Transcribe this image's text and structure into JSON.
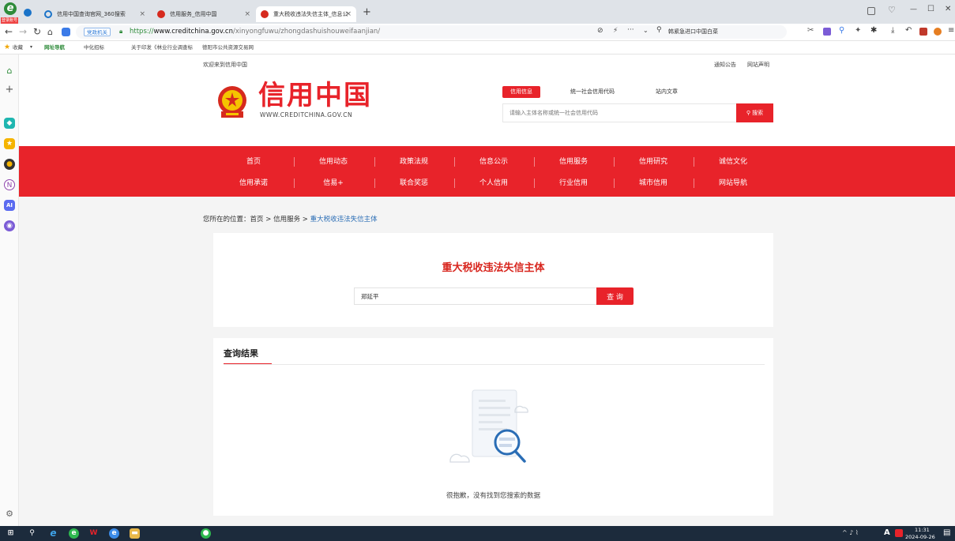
{
  "browser": {
    "profile_label": "登录账号",
    "tabs": [
      {
        "label": "信用中国查询官网_360搜索",
        "close": "×"
      },
      {
        "label": "信用服务_信用中国",
        "close": "×"
      },
      {
        "label": "重大税收违法失信主体_信息公",
        "close": "×"
      }
    ],
    "new_tab": "+",
    "window_controls": [
      "—",
      "☐",
      "✕"
    ],
    "address_badge": "党政机关",
    "url_prefix": "https://",
    "url_domain": "www.creditchina.gov.cn",
    "url_path": "/xinyongfuwu/zhongdashuishouweifaanjian/",
    "search_text": "韩紧急进口中国白菜",
    "bookmarks": [
      "收藏",
      "网址导航",
      "中化招标",
      "关于印发《林业行业调查标",
      "德阳市公共资源交易网"
    ]
  },
  "site": {
    "welcome": "欢迎来到信用中国",
    "top_links": [
      "通知公告",
      "网站声明"
    ],
    "logo_cn": "信用中国",
    "logo_en": "WWW.CREDITCHINA.GOV.CN",
    "search_tabs": [
      "信用信息",
      "统一社会信用代码",
      "站内文章"
    ],
    "search_placeholder": "请输入主体名称或统一社会信用代码",
    "search_button": "搜索",
    "nav_row1": [
      "首页",
      "信用动态",
      "政策法规",
      "信息公示",
      "信用服务",
      "信用研究",
      "诚信文化"
    ],
    "nav_row2": [
      "信用承诺",
      "信易+",
      "联合奖惩",
      "个人信用",
      "行业信用",
      "城市信用",
      "网站导航"
    ]
  },
  "breadcrumb": {
    "prefix": "您所在的位置：",
    "home": "首页",
    "sep1": " > ",
    "level2": "信用服务",
    "sep2": " > ",
    "current": "重大税收违法失信主体"
  },
  "query": {
    "title": "重大税收违法失信主体",
    "input_value": "郑延平",
    "button": "查 询"
  },
  "results": {
    "title": "查询结果",
    "empty_message": "很抱歉，没有找到您搜索的数据"
  },
  "taskbar": {
    "time": "11:31",
    "date": "2024-09-26",
    "ime": "A"
  },
  "colors": {
    "brand_red": "#e8232a",
    "link_blue": "#2a6db5"
  }
}
